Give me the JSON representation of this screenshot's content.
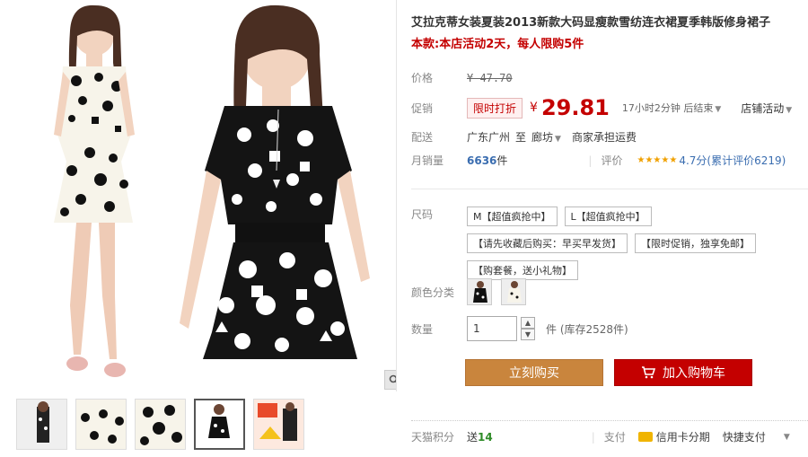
{
  "product": {
    "title": "艾拉克蒂女装夏装2013新款大码显瘦款雪纺连衣裙夏季韩版修身裙子",
    "promo": "本款:本店活动2天，每人限购5件"
  },
  "price": {
    "label": "价格",
    "original": "¥ 47.70"
  },
  "promo_price": {
    "label": "促销",
    "badge": "限时打折",
    "currency": "¥",
    "value": "29.81",
    "countdown": "17小时2分钟 后结束",
    "store_promo": "店铺活动"
  },
  "shipping": {
    "label": "配送",
    "from": "广东广州",
    "to_word": "至",
    "to": "廊坊",
    "note": "商家承担运费"
  },
  "sales": {
    "label": "月销量",
    "count": "6636",
    "unit": "件",
    "rating_label": "评价",
    "stars": "★★★★★",
    "rating_text": "4.7分(累计评价6219)"
  },
  "size": {
    "label": "尺码",
    "options": [
      "M【超值疯抢中】",
      "L【超值疯抢中】",
      "【请先收藏后购买：早买早发货】",
      "【限时促销，独享免邮】",
      "【购套餐，送小礼物】"
    ]
  },
  "color": {
    "label": "颜色分类"
  },
  "quantity": {
    "label": "数量",
    "value": "1",
    "unit_stock": "件 (库存2528件)"
  },
  "actions": {
    "buy_now": "立刻购买",
    "add_to_cart": "加入购物车"
  },
  "bottom": {
    "points_label": "天猫积分",
    "points_prefix": "送",
    "points_value": "14",
    "pay_label": "支付",
    "credit": "信用卡分期",
    "quick_pay": "快捷支付"
  },
  "colors": {
    "accent_red": "#c40000",
    "buy_orange": "#c9853d"
  }
}
